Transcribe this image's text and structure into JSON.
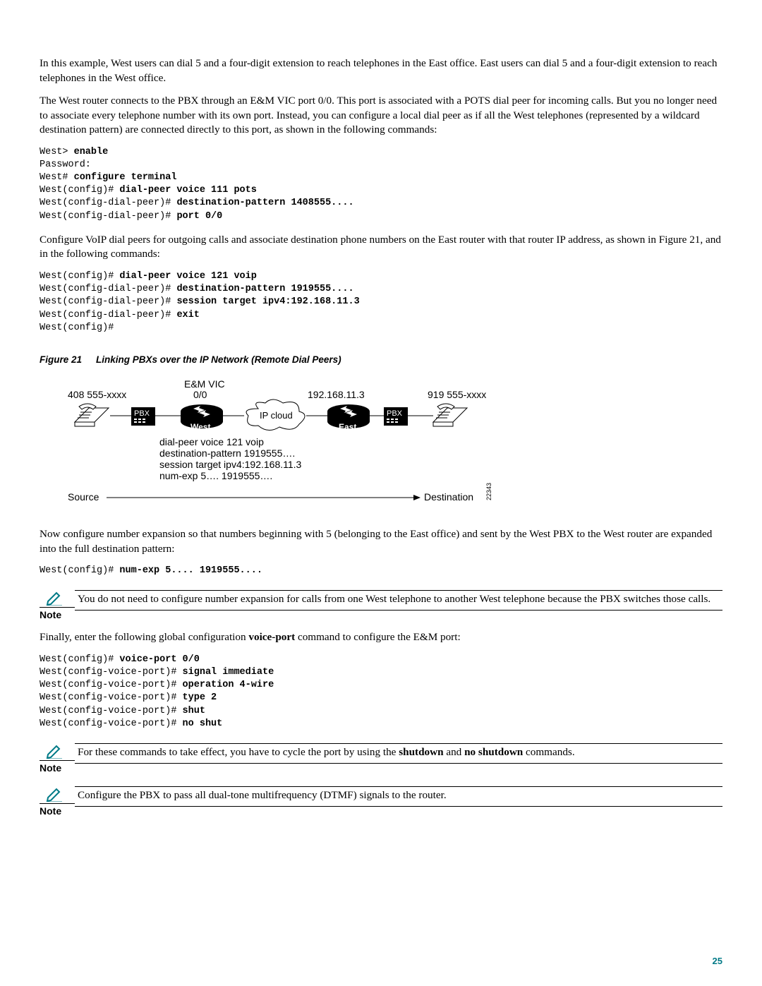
{
  "para1": "In this example, West users can dial 5 and a four-digit extension to reach telephones in the East office. East users can dial 5 and a four-digit extension to reach telephones in the West office.",
  "para2": "The West router connects to the PBX through an E&M VIC port 0/0. This port is associated with a POTS dial peer for incoming calls. But you no longer need to associate every telephone number with its own port. Instead, you can configure a local dial peer as if all the West telephones (represented by a wildcard destination pattern) are connected directly to this port, as shown in the following commands:",
  "code1": {
    "l1a": "West> ",
    "l1b": "enable",
    "l2a": "Password:",
    "l3a": "West# ",
    "l3b": "configure terminal",
    "l4a": "West(config)# ",
    "l4b": "dial-peer voice 111 pots",
    "l5a": "West(config-dial-peer)# ",
    "l5b": "destination-pattern 1408555....",
    "l6a": "West(config-dial-peer)# ",
    "l6b": "port 0/0"
  },
  "para3": "Configure VoIP dial peers for outgoing calls and associate destination phone numbers on the East router with that router IP address, as shown in Figure 21, and in the following commands:",
  "code2": {
    "l1a": "West(config)# ",
    "l1b": "dial-peer voice 121 voip",
    "l2a": "West(config-dial-peer)# ",
    "l2b": "destination-pattern 1919555....",
    "l3a": "West(config-dial-peer)# ",
    "l3b": "session target ipv4:192.168.11.3",
    "l4a": "West(config-dial-peer)# ",
    "l4b": "exit",
    "l5a": "West(config)#"
  },
  "fig": {
    "num": "Figure 21",
    "title": "Linking PBXs over the IP Network (Remote Dial Peers)",
    "labels": {
      "phone_left": "408 555-xxxx",
      "em_vic": "E&M VIC",
      "port": "0/0",
      "ip_cloud": "IP cloud",
      "ip_east": "192.168.11.3",
      "phone_right": "919 555-xxxx",
      "west": "West",
      "east": "East",
      "pbx": "PBX",
      "cfg1": "dial-peer voice 121 voip",
      "cfg2": " destination-pattern 1919555….",
      "cfg3": " session target ipv4:192.168.11.3",
      "cfg4": " num-exp 5…. 1919555….",
      "source": "Source",
      "destination": "Destination",
      "id": "22343"
    }
  },
  "para4": "Now configure number expansion so that numbers beginning with 5 (belonging to the East office) and sent by the West PBX to the West router are expanded into the full destination pattern:",
  "code3": {
    "l1a": "West(config)# ",
    "l1b": "num-exp 5.... 1919555...."
  },
  "note1_label": "Note",
  "note1": "You do not need to configure number expansion for calls from one West telephone to another West telephone because the PBX switches those calls.",
  "para5_a": "Finally, enter the following global configuration ",
  "para5_b": "voice-port",
  "para5_c": " command to configure the E&M port:",
  "code4": {
    "l1a": "West(config)# ",
    "l1b": "voice-port 0/0",
    "l2a": "West(config-voice-port)# ",
    "l2b": "signal immediate",
    "l3a": "West(config-voice-port)# ",
    "l3b": "operation 4-wire",
    "l4a": "West(config-voice-port)# ",
    "l4b": "type 2",
    "l5a": "West(config-voice-port)# ",
    "l5b": "shut",
    "l6a": "West(config-voice-port)# ",
    "l6b": "no shut"
  },
  "note2_label": "Note",
  "note2_a": "For these commands to take effect, you have to cycle the port by using the ",
  "note2_b": "shutdown",
  "note2_c": " and ",
  "note2_d": "no shutdown",
  "note2_e": " commands.",
  "note3_label": "Note",
  "note3": "Configure the PBX to pass all dual-tone multifrequency (DTMF) signals to the router.",
  "pagenum": "25"
}
